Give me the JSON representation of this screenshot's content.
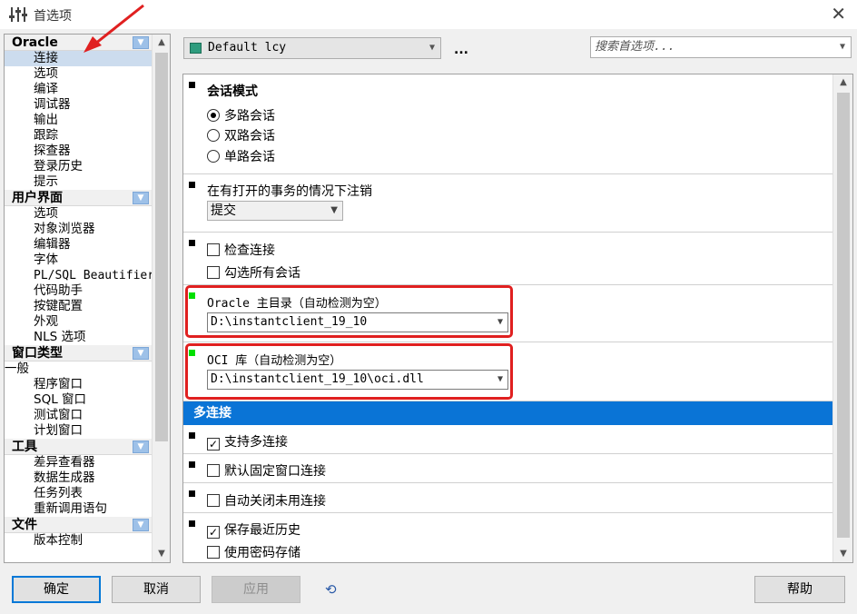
{
  "window": {
    "title": "首选项",
    "close_glyph": "✕"
  },
  "tree": {
    "groups": [
      {
        "label": "Oracle",
        "items": [
          "连接",
          "选项",
          "编译",
          "调试器",
          "输出",
          "跟踪",
          "探查器",
          "登录历史",
          "提示"
        ]
      },
      {
        "label": "用户界面",
        "items": [
          "选项",
          "对象浏览器",
          "编辑器",
          "字体",
          "PL/SQL Beautifier",
          "代码助手",
          "按键配置",
          "外观",
          "NLS 选项"
        ]
      },
      {
        "label": "窗口类型",
        "flat_item": "一般",
        "items": [
          "程序窗口",
          "SQL 窗口",
          "测试窗口",
          "计划窗口"
        ]
      },
      {
        "label": "工具",
        "items": [
          "差异查看器",
          "数据生成器",
          "任务列表",
          "重新调用语句"
        ]
      },
      {
        "label": "文件",
        "items": [
          "版本控制"
        ]
      }
    ],
    "selected_item": "连接"
  },
  "toolbar": {
    "profile": "Default lcy",
    "more": "...",
    "search_placeholder": "搜索首选项..."
  },
  "sections": {
    "session_mode": {
      "title": "会话模式",
      "options": [
        "多路会话",
        "双路会话",
        "单路会话"
      ],
      "selected": "多路会话"
    },
    "logoff": {
      "title": "在有打开的事务的情况下注销",
      "value": "提交"
    },
    "checks": {
      "check_connection": "检查连接",
      "check_all_sessions": "勾选所有会话"
    },
    "oracle_home": {
      "title": "Oracle 主目录（自动检测为空）",
      "value": "D:\\instantclient_19_10"
    },
    "oci_lib": {
      "title": "OCI 库（自动检测为空）",
      "value": "D:\\instantclient_19_10\\oci.dll"
    },
    "multi_connect": {
      "banner": "多连接",
      "support": {
        "label": "支持多连接",
        "checked": true
      },
      "default_fixed": {
        "label": "默认固定窗口连接",
        "checked": false
      },
      "auto_close": {
        "label": "自动关闭未用连接",
        "checked": false
      },
      "save_history": {
        "label": "保存最近历史",
        "checked": true
      },
      "password_store": {
        "label": "使用密码存储",
        "checked": false
      }
    }
  },
  "buttons": {
    "ok": "确定",
    "cancel": "取消",
    "apply": "应用",
    "help": "帮助"
  },
  "colors": {
    "accent": "#0A74D6",
    "highlight_box": "#E02020",
    "selected_row": "#CCDCEE"
  }
}
